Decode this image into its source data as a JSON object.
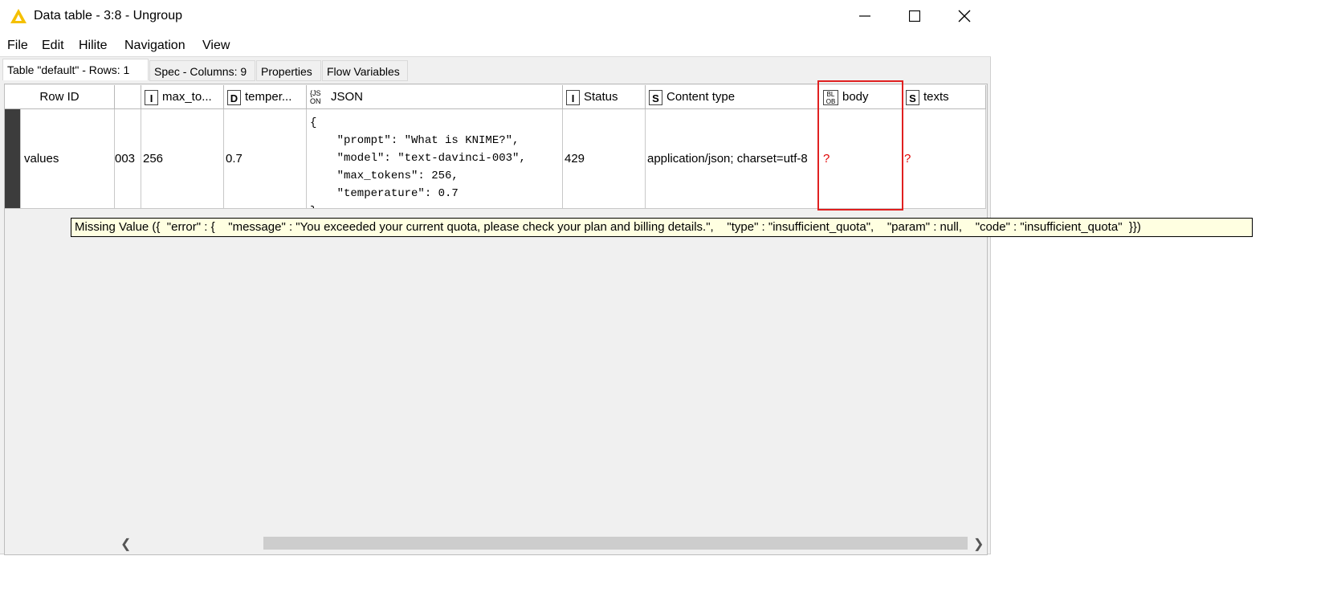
{
  "window": {
    "title": "Data table - 3:8 - Ungroup",
    "minimize_icon": "minimize-icon",
    "maximize_icon": "maximize-icon",
    "close_icon": "close-icon"
  },
  "menu": [
    "File",
    "Edit",
    "Hilite",
    "Navigation",
    "View"
  ],
  "tabs": [
    "Table \"default\" - Rows: 1",
    "Spec - Columns: 9",
    "Properties",
    "Flow Variables"
  ],
  "columns": [
    {
      "name": "Row ID",
      "type": ""
    },
    {
      "name": "",
      "type": ""
    },
    {
      "name": "max_to...",
      "type": "I"
    },
    {
      "name": "temper...",
      "type": "D"
    },
    {
      "name": "JSON",
      "type": "{JS ON"
    },
    {
      "name": "Status",
      "type": "I"
    },
    {
      "name": "Content type",
      "type": "S"
    },
    {
      "name": "body",
      "type": "BL OB"
    },
    {
      "name": "texts",
      "type": "S"
    }
  ],
  "row": {
    "row_id": "values",
    "col1": "003",
    "max_tokens": "256",
    "temperature": "0.7",
    "json": "{\n    \"prompt\": \"What is KNIME?\",\n    \"model\": \"text-davinci-003\",\n    \"max_tokens\": 256,\n    \"temperature\": 0.7\n}",
    "status": "429",
    "content_type": "application/json; charset=utf-8",
    "body": "?",
    "texts": "?"
  },
  "tooltip": "Missing Value ({  \"error\" : {    \"message\" : \"You exceeded your current quota, please check your plan and billing details.\",    \"type\" : \"insufficient_quota\",    \"param\" : null,    \"code\" : \"insufficient_quota\"  }})",
  "colors": {
    "highlight": "#e02020",
    "missing": "#e00000",
    "tooltip_bg": "#ffffe1"
  }
}
